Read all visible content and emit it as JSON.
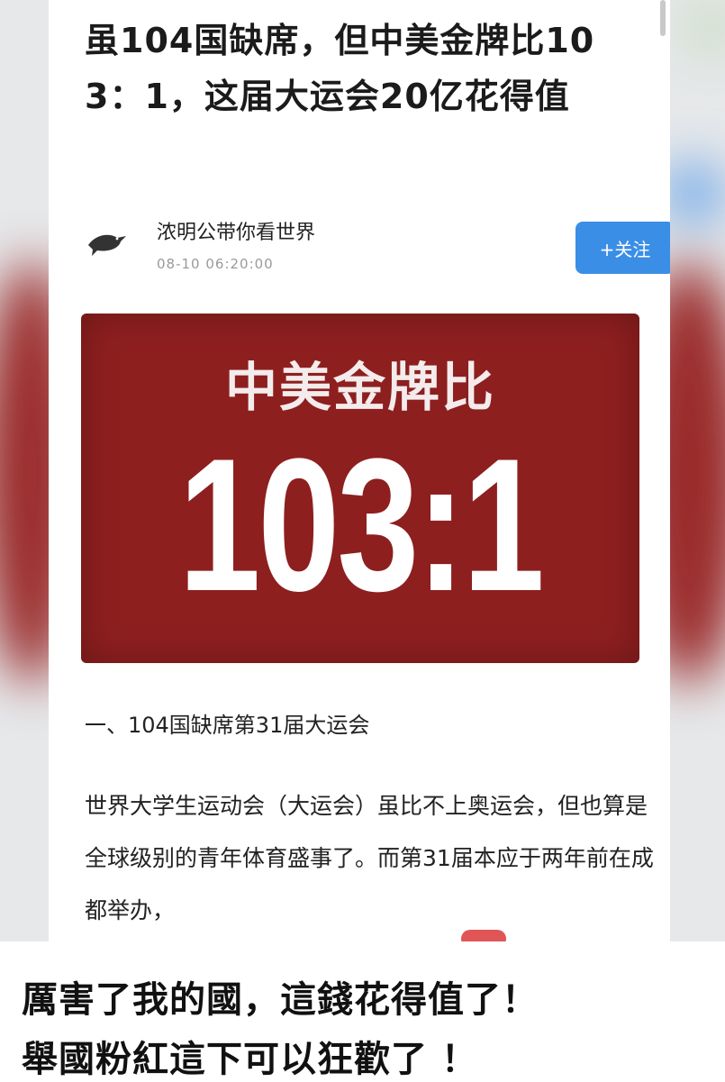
{
  "article": {
    "title": "虽104国缺席，但中美金牌比103：1，这届大运会20亿花得值",
    "author": {
      "name": "浓明公带你看世界",
      "timestamp": "08-10 06:20:00"
    },
    "follow_label": "+关注",
    "banner": {
      "heading": "中美金牌比",
      "score": "103:1",
      "background_color": "#8e1f1f"
    },
    "section_heading": "一、104国缺席第31届大运会",
    "body": "世界大学生运动会（大运会）虽比不上奥运会，但也算是全球级别的青年体育盛事了。而第31届本应于两年前在成都举办，"
  },
  "caption": {
    "line1": "厲害了我的國，這錢花得值了！",
    "line2": "舉國粉紅這下可以狂歡了 ！"
  },
  "colors": {
    "follow_button": "#3b8ee6"
  }
}
